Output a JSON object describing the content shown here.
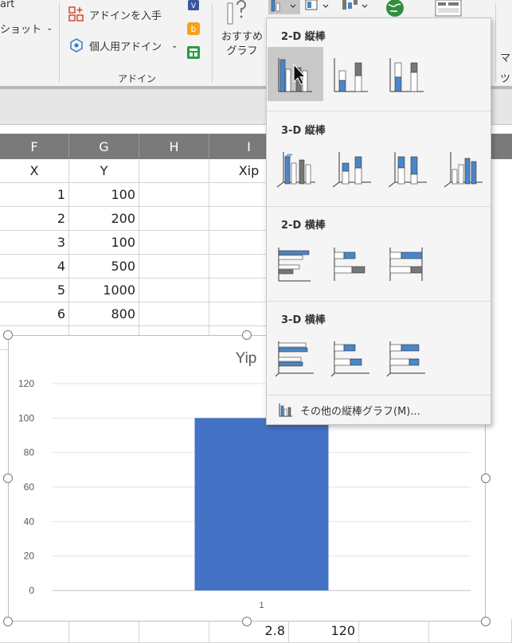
{
  "ribbon": {
    "partial_art": "art",
    "screenshot": "ショット",
    "get_addins": "アドインを入手",
    "my_addins": "個人用アドイン",
    "addins_group": "アドイン",
    "recommended_line1": "おすすめ",
    "recommended_line2": "グラフ",
    "right_partial_1": "マ",
    "right_partial_2": "ツ"
  },
  "columns": [
    "F",
    "G",
    "H",
    "I"
  ],
  "sheet": {
    "header_row": {
      "F": "X",
      "G": "Y",
      "I": "Xip"
    },
    "rows": [
      {
        "x": "1",
        "y": "100"
      },
      {
        "x": "2",
        "y": "200"
      },
      {
        "x": "3",
        "y": "100"
      },
      {
        "x": "4",
        "y": "500"
      },
      {
        "x": "5",
        "y": "1000"
      },
      {
        "x": "6",
        "y": "800"
      }
    ],
    "bottom_row": {
      "i": "2.8",
      "j": "120"
    }
  },
  "dropdown": {
    "sections": [
      "2-D 縦棒",
      "3-D 縦棒",
      "2-D 横棒",
      "3-D 横棒"
    ],
    "more_label": "その他の縦棒グラフ(M)..."
  },
  "chart_data": {
    "type": "bar",
    "title": "Yip",
    "categories": [
      "1"
    ],
    "values": [
      100
    ],
    "ylim": [
      0,
      120
    ],
    "yticks": [
      0,
      20,
      40,
      60,
      80,
      100,
      120
    ],
    "grid": true,
    "color": "#4472c4"
  }
}
